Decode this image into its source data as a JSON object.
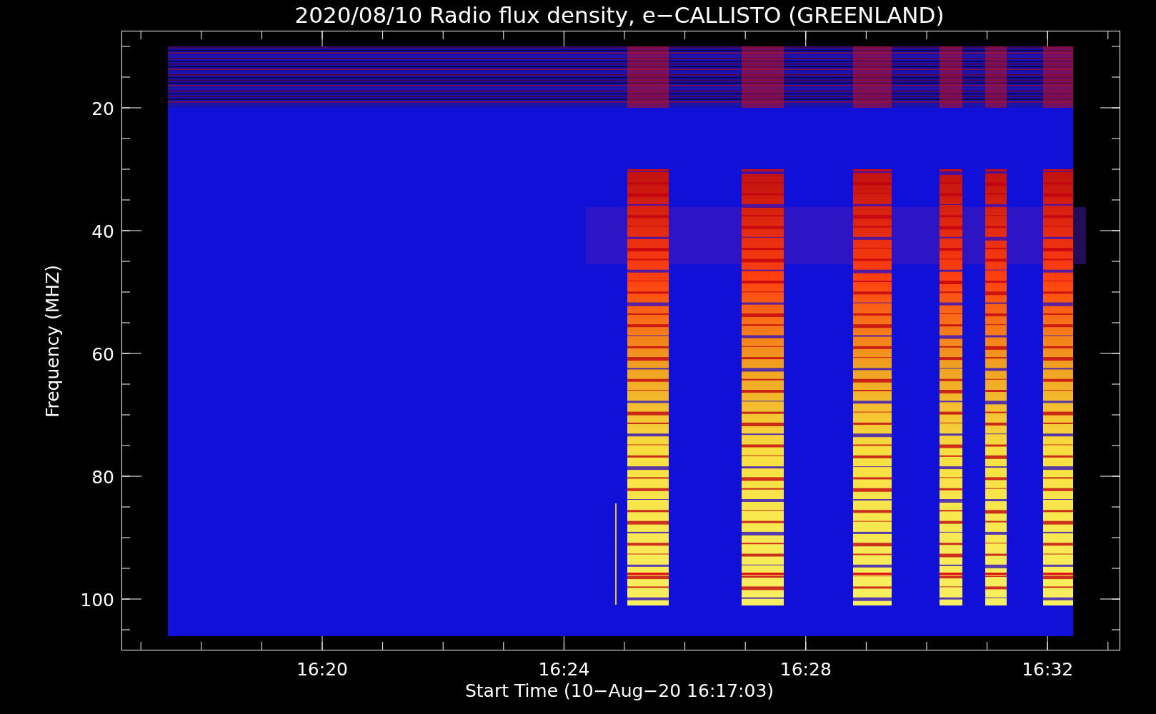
{
  "title": "2020/08/10  Radio flux density, e−CALLISTO (GREENLAND)",
  "plot": {
    "ylabel": "Frequency (MHZ)",
    "xlabel": "Start Time (10−Aug−20 16:17:03)",
    "yticks": [
      "20",
      "40",
      "60",
      "80",
      "100"
    ],
    "xticks": [
      "16:20",
      "16:24",
      "16:28",
      "16:32"
    ]
  }
}
